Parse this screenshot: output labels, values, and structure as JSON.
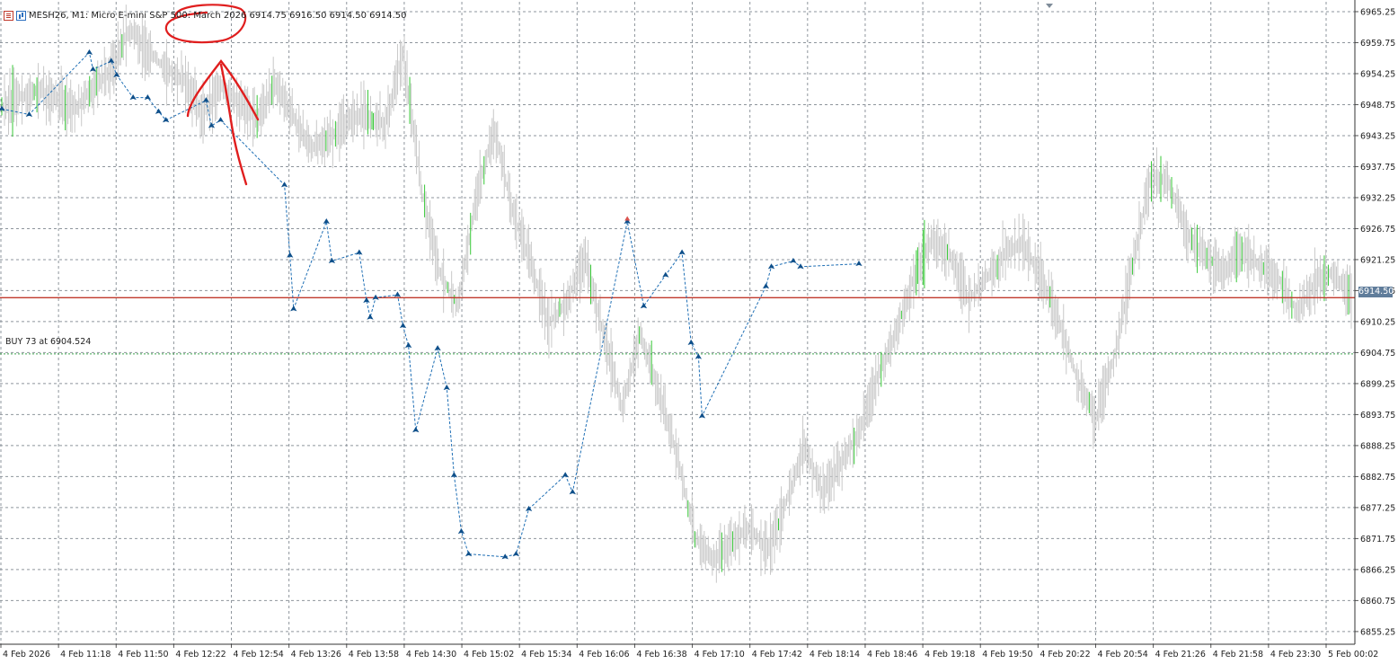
{
  "header": {
    "symbol_text": "MESH26, M1:  Micro E-mini S&P 500: March 2026  6914.75 6916.50 6914.50 6914.50",
    "chart_icon": "chart-window-icon",
    "bars_icon": "bar-chart-icon"
  },
  "current_price_label": "6914.50",
  "order_label": "BUY 73 at 6904.524",
  "colors": {
    "background": "#ffffff",
    "grid": "#8e959c",
    "candle_neutral": "#c8c8c8",
    "candle_bull": "#37c837",
    "zigzag": "#1f6fb5",
    "marker": "#0e4f8a",
    "bid_line": "#c0392b",
    "order_line": "#3fa34d",
    "annotation": "#e01e1e",
    "price_tag_bg": "#607d9b"
  },
  "chart_data": {
    "type": "candlestick",
    "symbol": "MESH26",
    "timeframe": "M1",
    "ohlc_last": {
      "open": 6914.75,
      "high": 6916.5,
      "low": 6914.5,
      "close": 6914.5
    },
    "y_ticks": [
      6965.25,
      6959.75,
      6954.25,
      6948.75,
      6943.25,
      6937.75,
      6932.25,
      6926.75,
      6921.25,
      6915.75,
      6910.25,
      6904.75,
      6899.25,
      6893.75,
      6888.25,
      6882.75,
      6877.25,
      6871.75,
      6866.25,
      6860.75,
      6855.25
    ],
    "x_ticks": [
      "4 Feb 2026",
      "4 Feb 11:18",
      "4 Feb 11:50",
      "4 Feb 12:22",
      "4 Feb 12:54",
      "4 Feb 13:26",
      "4 Feb 13:58",
      "4 Feb 14:30",
      "4 Feb 15:02",
      "4 Feb 15:34",
      "4 Feb 16:06",
      "4 Feb 16:38",
      "4 Feb 17:10",
      "4 Feb 17:42",
      "4 Feb 18:14",
      "4 Feb 18:46",
      "4 Feb 19:18",
      "4 Feb 19:50",
      "4 Feb 20:22",
      "4 Feb 20:54",
      "4 Feb 21:26",
      "4 Feb 21:58",
      "4 Feb 23:30",
      "5 Feb 00:02"
    ],
    "ylim": [
      6853.0,
      6967.0
    ],
    "grid": true,
    "bid_price": 6914.5,
    "order": {
      "side": "BUY",
      "volume": 73,
      "price": 6904.524
    },
    "price_path": [
      [
        0,
        6948.5
      ],
      [
        2,
        6951.5
      ],
      [
        4,
        6948.0
      ],
      [
        6,
        6955.0
      ],
      [
        7,
        6962.0
      ],
      [
        8,
        6958.5
      ],
      [
        9,
        6955.0
      ],
      [
        10,
        6953.0
      ],
      [
        11,
        6947.0
      ],
      [
        12,
        6952.0
      ],
      [
        13,
        6949.0
      ],
      [
        14,
        6946.0
      ],
      [
        15,
        6952.5
      ],
      [
        16,
        6946.5
      ],
      [
        17,
        6941.0
      ],
      [
        18,
        6943.0
      ],
      [
        19,
        6946.0
      ],
      [
        20,
        6947.0
      ],
      [
        21,
        6945.0
      ],
      [
        22,
        6958.0
      ],
      [
        23,
        6934.0
      ],
      [
        24,
        6919.0
      ],
      [
        25,
        6913.0
      ],
      [
        26,
        6932.0
      ],
      [
        27,
        6945.0
      ],
      [
        28,
        6930.0
      ],
      [
        29,
        6920.5
      ],
      [
        30,
        6910.0
      ],
      [
        31,
        6914.0
      ],
      [
        32,
        6921.5
      ],
      [
        33,
        6908.0
      ],
      [
        34,
        6895.0
      ],
      [
        35,
        6908.0
      ],
      [
        36,
        6898.0
      ],
      [
        37,
        6887.0
      ],
      [
        38,
        6872.0
      ],
      [
        39,
        6868.0
      ],
      [
        40,
        6871.0
      ],
      [
        41,
        6874.0
      ],
      [
        42,
        6869.5
      ],
      [
        43,
        6878.0
      ],
      [
        44,
        6888.0
      ],
      [
        45,
        6880.0
      ],
      [
        46,
        6885.0
      ],
      [
        47,
        6890.5
      ],
      [
        48,
        6900.0
      ],
      [
        49,
        6908.0
      ],
      [
        50,
        6918.0
      ],
      [
        51,
        6925.0
      ],
      [
        52,
        6922.0
      ],
      [
        53,
        6914.0
      ],
      [
        54,
        6918.0
      ],
      [
        55,
        6922.5
      ],
      [
        56,
        6924.0
      ],
      [
        57,
        6918.0
      ],
      [
        58,
        6910.0
      ],
      [
        59,
        6900.0
      ],
      [
        60,
        6893.0
      ],
      [
        61,
        6904.0
      ],
      [
        62,
        6920.0
      ],
      [
        63,
        6936.0
      ],
      [
        64,
        6935.0
      ],
      [
        65,
        6926.0
      ],
      [
        66,
        6922.0
      ],
      [
        67,
        6919.0
      ],
      [
        68,
        6923.0
      ],
      [
        69,
        6920.0
      ],
      [
        70,
        6918.0
      ],
      [
        71,
        6912.0
      ],
      [
        72,
        6917.0
      ],
      [
        73,
        6919.0
      ],
      [
        74,
        6914.5
      ]
    ],
    "zigzag": [
      {
        "t": 0,
        "price": 6948.0
      },
      {
        "t": 1.5,
        "price": 6947.0
      },
      {
        "t": 4.8,
        "price": 6958.0
      },
      {
        "t": 5.0,
        "price": 6955.0
      },
      {
        "t": 6.0,
        "price": 6956.5
      },
      {
        "t": 6.3,
        "price": 6954.0
      },
      {
        "t": 7.2,
        "price": 6950.0
      },
      {
        "t": 8.0,
        "price": 6950.0
      },
      {
        "t": 8.6,
        "price": 6947.5
      },
      {
        "t": 9.0,
        "price": 6946.0
      },
      {
        "t": 11.2,
        "price": 6949.5
      },
      {
        "t": 11.5,
        "price": 6945.0
      },
      {
        "t": 12.0,
        "price": 6946.0
      },
      {
        "t": 15.5,
        "price": 6934.5
      },
      {
        "t": 15.8,
        "price": 6922.0
      },
      {
        "t": 16.0,
        "price": 6912.5
      },
      {
        "t": 17.8,
        "price": 6928.0
      },
      {
        "t": 18.1,
        "price": 6921.0
      },
      {
        "t": 19.6,
        "price": 6922.5
      },
      {
        "t": 20.0,
        "price": 6914.0
      },
      {
        "t": 20.2,
        "price": 6911.0
      },
      {
        "t": 20.5,
        "price": 6914.5
      },
      {
        "t": 21.7,
        "price": 6915.0
      },
      {
        "t": 22.0,
        "price": 6909.5
      },
      {
        "t": 22.3,
        "price": 6906.0
      },
      {
        "t": 22.7,
        "price": 6891.0
      },
      {
        "t": 23.9,
        "price": 6905.5
      },
      {
        "t": 24.4,
        "price": 6898.5
      },
      {
        "t": 24.8,
        "price": 6883.0
      },
      {
        "t": 25.2,
        "price": 6873.0
      },
      {
        "t": 25.6,
        "price": 6869.0
      },
      {
        "t": 27.6,
        "price": 6868.5
      },
      {
        "t": 28.2,
        "price": 6869.0
      },
      {
        "t": 28.9,
        "price": 6877.0
      },
      {
        "t": 30.9,
        "price": 6883.0
      },
      {
        "t": 31.3,
        "price": 6880.0
      },
      {
        "t": 34.3,
        "price": 6928.0
      },
      {
        "t": 35.2,
        "price": 6913.0
      },
      {
        "t": 36.4,
        "price": 6918.5
      },
      {
        "t": 37.3,
        "price": 6922.5
      },
      {
        "t": 37.8,
        "price": 6906.5
      },
      {
        "t": 38.2,
        "price": 6904.0
      },
      {
        "t": 38.4,
        "price": 6893.5
      },
      {
        "t": 41.9,
        "price": 6916.5
      },
      {
        "t": 42.2,
        "price": 6920.0
      },
      {
        "t": 43.4,
        "price": 6921.0
      },
      {
        "t": 43.8,
        "price": 6920.0
      },
      {
        "t": 47.0,
        "price": 6920.5
      }
    ],
    "red_marker": {
      "t": 34.3,
      "price": 6928.5
    },
    "annotation": "hand-drawn red circle around OHLC values in header and a red arrow pointing to it"
  }
}
